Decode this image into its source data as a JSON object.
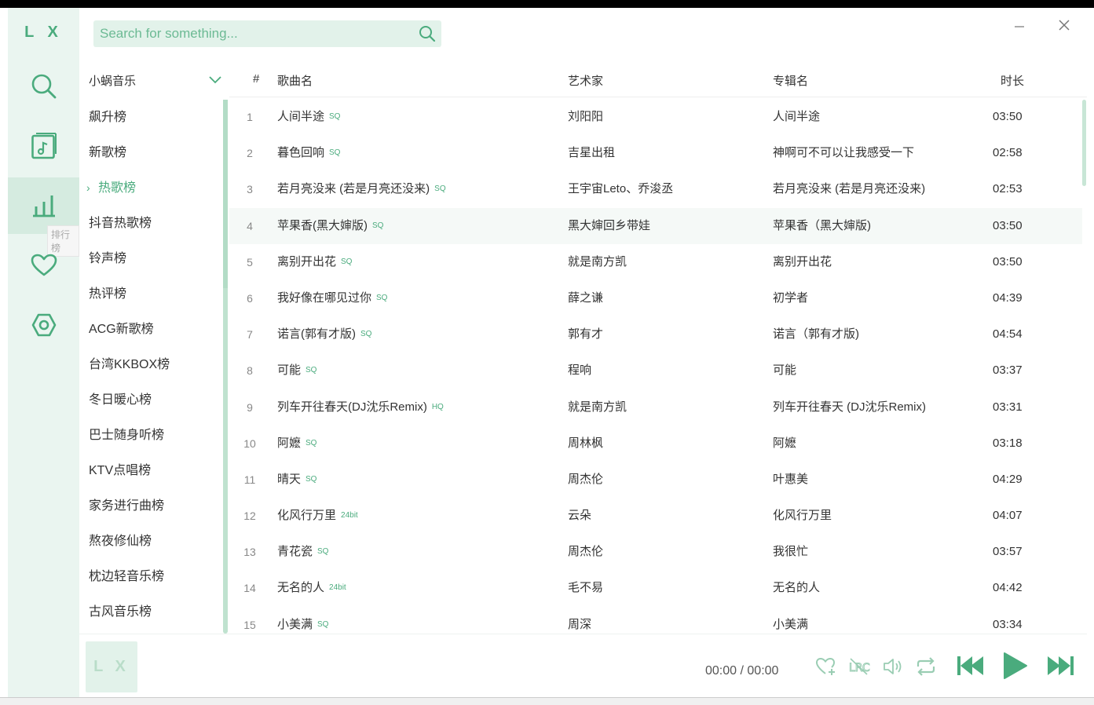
{
  "app": {
    "logo": "L X"
  },
  "search": {
    "placeholder": "Search for something..."
  },
  "rail": {
    "tooltip": "排行榜"
  },
  "source": {
    "label": "小蜗音乐"
  },
  "categories": [
    "飙升榜",
    "新歌榜",
    "热歌榜",
    "抖音热歌榜",
    "铃声榜",
    "热评榜",
    "ACG新歌榜",
    "台湾KKBOX榜",
    "冬日暖心榜",
    "巴士随身听榜",
    "KTV点唱榜",
    "家务进行曲榜",
    "熬夜修仙榜",
    "枕边轻音乐榜",
    "古风音乐榜"
  ],
  "active_category": "热歌榜",
  "table": {
    "headers": {
      "index": "#",
      "name": "歌曲名",
      "artist": "艺术家",
      "album": "专辑名",
      "duration": "时长"
    },
    "rows": [
      {
        "index": "1",
        "name": "人间半途",
        "quality": "SQ",
        "artist": "刘阳阳",
        "album": "人间半途",
        "duration": "03:50"
      },
      {
        "index": "2",
        "name": "暮色回响",
        "quality": "SQ",
        "artist": "吉星出租",
        "album": "神啊可不可以让我感受一下",
        "duration": "02:58"
      },
      {
        "index": "3",
        "name": "若月亮没来 (若是月亮还没来)",
        "quality": "SQ",
        "artist": "王宇宙Leto、乔浚丞",
        "album": "若月亮没来 (若是月亮还没来)",
        "duration": "02:53"
      },
      {
        "index": "4",
        "name": "苹果香(黑大婶版)",
        "quality": "SQ",
        "artist": "黑大婶回乡带娃",
        "album": "苹果香（黑大婶版)",
        "duration": "03:50"
      },
      {
        "index": "5",
        "name": "离别开出花",
        "quality": "SQ",
        "artist": "就是南方凯",
        "album": "离别开出花",
        "duration": "03:50"
      },
      {
        "index": "6",
        "name": "我好像在哪见过你",
        "quality": "SQ",
        "artist": "薛之谦",
        "album": "初学者",
        "duration": "04:39"
      },
      {
        "index": "7",
        "name": "诺言(郭有才版)",
        "quality": "SQ",
        "artist": "郭有才",
        "album": "诺言（郭有才版)",
        "duration": "04:54"
      },
      {
        "index": "8",
        "name": "可能",
        "quality": "SQ",
        "artist": "程响",
        "album": "可能",
        "duration": "03:37"
      },
      {
        "index": "9",
        "name": "列车开往春天(DJ沈乐Remix)",
        "quality": "HQ",
        "artist": "就是南方凯",
        "album": "列车开往春天 (DJ沈乐Remix)",
        "duration": "03:31"
      },
      {
        "index": "10",
        "name": "阿嬷",
        "quality": "SQ",
        "artist": "周林枫",
        "album": "阿嬷",
        "duration": "03:18"
      },
      {
        "index": "11",
        "name": "晴天",
        "quality": "SQ",
        "artist": "周杰伦",
        "album": "叶惠美",
        "duration": "04:29"
      },
      {
        "index": "12",
        "name": "化风行万里",
        "quality": "24bit",
        "artist": "云朵",
        "album": "化风行万里",
        "duration": "04:07"
      },
      {
        "index": "13",
        "name": "青花瓷",
        "quality": "SQ",
        "artist": "周杰伦",
        "album": "我很忙",
        "duration": "03:57"
      },
      {
        "index": "14",
        "name": "无名的人",
        "quality": "24bit",
        "artist": "毛不易",
        "album": "无名的人",
        "duration": "04:42"
      },
      {
        "index": "15",
        "name": "小美满",
        "quality": "SQ",
        "artist": "周深",
        "album": "小美满",
        "duration": "03:34"
      }
    ]
  },
  "player": {
    "cover_text": "L X",
    "current_time": "00:00",
    "separator": "/",
    "total_time": "00:00"
  },
  "colors": {
    "accent": "#4aab7d",
    "rail_bg": "#eaf5f0",
    "search_bg": "#e2f2ea"
  }
}
